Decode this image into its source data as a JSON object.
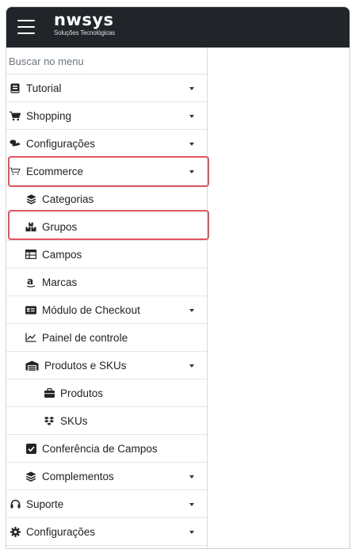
{
  "header": {
    "logo_name": "nwsys",
    "logo_tagline": "Soluções Tecnológicas"
  },
  "menu": {
    "search_placeholder": "Buscar no menu",
    "items": [
      {
        "label": "Tutorial",
        "icon": "book-icon",
        "expanded": false
      },
      {
        "label": "Shopping",
        "icon": "shopping-cart-icon",
        "expanded": false
      },
      {
        "label": "Configurações",
        "icon": "wrench-icon",
        "expanded": false
      },
      {
        "label": "Ecommerce",
        "icon": "cart-outline-icon",
        "expanded": true,
        "highlighted": true
      },
      {
        "label": "Categorias",
        "icon": "layers-icon"
      },
      {
        "label": "Grupos",
        "icon": "cubes-icon",
        "highlighted": true
      },
      {
        "label": "Campos",
        "icon": "table-icon"
      },
      {
        "label": "Marcas",
        "icon": "amazon-icon"
      },
      {
        "label": "Módulo de Checkout",
        "icon": "id-card-icon",
        "expanded": false
      },
      {
        "label": "Painel de controle",
        "icon": "chart-line-icon"
      },
      {
        "label": "Produtos e SKUs",
        "icon": "warehouse-icon",
        "expanded": true
      },
      {
        "label": "Produtos",
        "icon": "briefcase-icon"
      },
      {
        "label": "SKUs",
        "icon": "dropbox-icon"
      },
      {
        "label": "Conferência de Campos",
        "icon": "check-square-icon"
      },
      {
        "label": "Complementos",
        "icon": "layers-icon",
        "expanded": false
      },
      {
        "label": "Suporte",
        "icon": "headset-icon",
        "expanded": false
      },
      {
        "label": "Configurações",
        "icon": "gear-icon",
        "expanded": false
      }
    ]
  },
  "colors": {
    "topbar": "#212529",
    "highlight_border": "#e05561"
  }
}
